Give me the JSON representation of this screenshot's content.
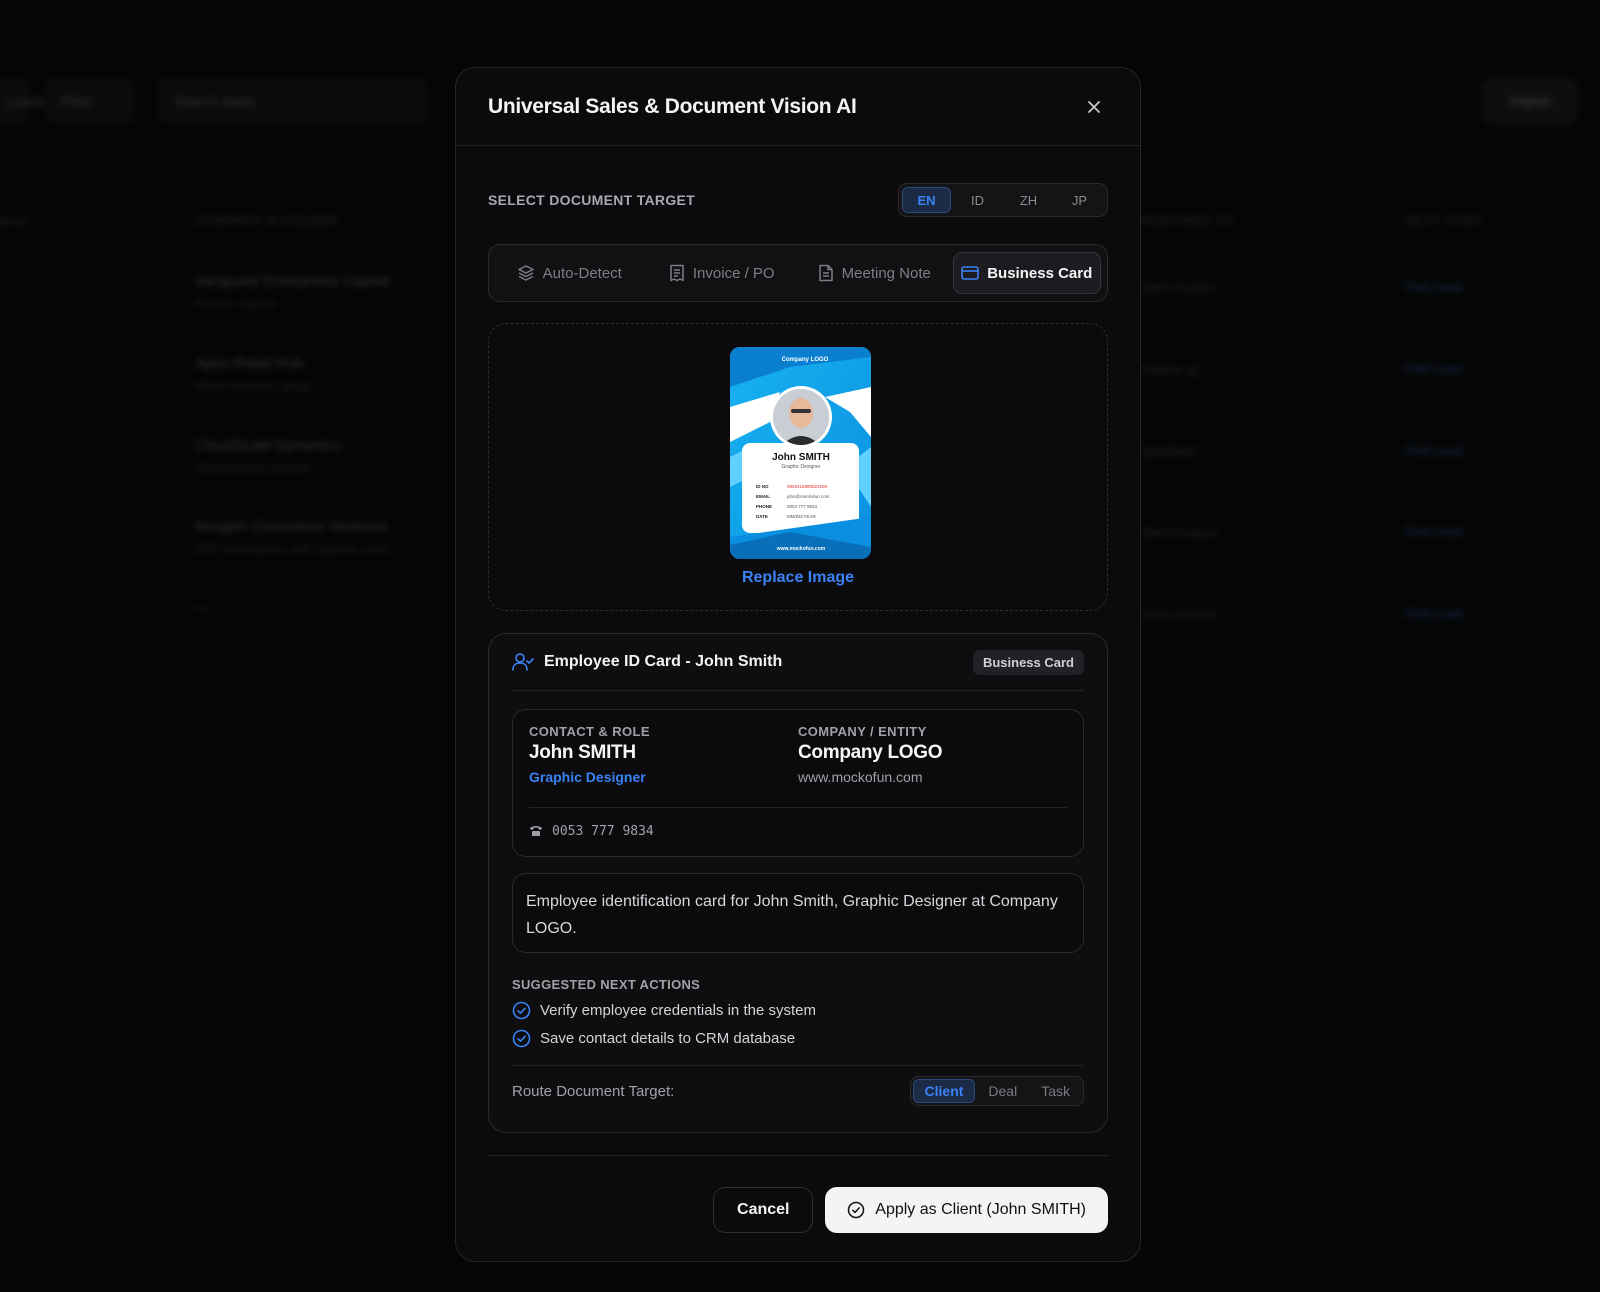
{
  "background": {
    "toolbar": {
      "chip1": "Leads",
      "chip2": "Filter",
      "chip3": "Search leads",
      "import": "Import"
    },
    "headers": [
      "Name",
      "COMPANY & HOLDER",
      "ASSIGNED TO",
      "NEXT STEP"
    ],
    "rows": [
      {
        "name": "Vanguard Enterprises Capital",
        "sub": "Partner Capital",
        "col": "Sent invoice",
        "badge": "Find Lead"
      },
      {
        "name": "Apex Retail Hub",
        "sub": "Retail franchise group",
        "col": "Follow up",
        "badge": "Find Lead"
      },
      {
        "name": "CloudScale Dynamics",
        "sub": "Infrastructure provider",
        "col": "Qualified",
        "badge": "Find Lead"
      },
      {
        "name": "Nexgen Commerce Ventures",
        "sub": "B2B marketplace with regional reach",
        "col": "Sent invoice",
        "badge": "Find Lead"
      },
      {
        "name": "—",
        "sub": "",
        "col": "Sent invoice",
        "badge": "Find Lead"
      }
    ]
  },
  "modal": {
    "title": "Universal Sales & Document Vision AI",
    "section_label": "SELECT DOCUMENT TARGET",
    "languages": [
      {
        "label": "EN",
        "active": true
      },
      {
        "label": "ID",
        "active": false
      },
      {
        "label": "ZH",
        "active": false
      },
      {
        "label": "JP",
        "active": false
      }
    ],
    "doc_types": [
      {
        "label": "Auto-Detect",
        "icon": "layers-icon",
        "active": false
      },
      {
        "label": "Invoice / PO",
        "icon": "receipt-icon",
        "active": false
      },
      {
        "label": "Meeting Note",
        "icon": "document-icon",
        "active": false
      },
      {
        "label": "Business Card",
        "icon": "credit-card-icon",
        "active": true
      }
    ],
    "preview": {
      "card_logo": "Company LOGO",
      "card_name": "John SMITH",
      "card_role": "Graphic Designer",
      "card_fields": [
        {
          "k": "ID NO",
          "v": "0903418989021909"
        },
        {
          "k": "EMAIL",
          "v": "john@mockofun.com"
        },
        {
          "k": "PHONE",
          "v": "0053 777 9834"
        },
        {
          "k": "DATE",
          "v": "MM/DD/YEAR"
        }
      ],
      "card_site": "www.mockofun.com",
      "replace_label": "Replace Image"
    },
    "result": {
      "title": "Employee ID Card - John Smith",
      "tag": "Business Card",
      "contact_label": "CONTACT & ROLE",
      "contact_name": "John SMITH",
      "contact_role": "Graphic Designer",
      "company_label": "COMPANY / ENTITY",
      "company_name": "Company LOGO",
      "company_site": "www.mockofun.com",
      "phone": "0053 777 9834",
      "description": "Employee identification card for John Smith, Graphic Designer at Company LOGO.",
      "actions_label": "SUGGESTED NEXT ACTIONS",
      "actions": [
        "Verify employee credentials in the system",
        "Save contact details to CRM database"
      ],
      "route_label": "Route Document Target:",
      "routes": [
        {
          "label": "Client",
          "active": true
        },
        {
          "label": "Deal",
          "active": false
        },
        {
          "label": "Task",
          "active": false
        }
      ]
    },
    "footer": {
      "cancel": "Cancel",
      "apply": "Apply as Client (John SMITH)"
    }
  },
  "colors": {
    "accent": "#3b82f6",
    "modal_bg": "#0b0b0d",
    "page_bg": "#050505"
  }
}
